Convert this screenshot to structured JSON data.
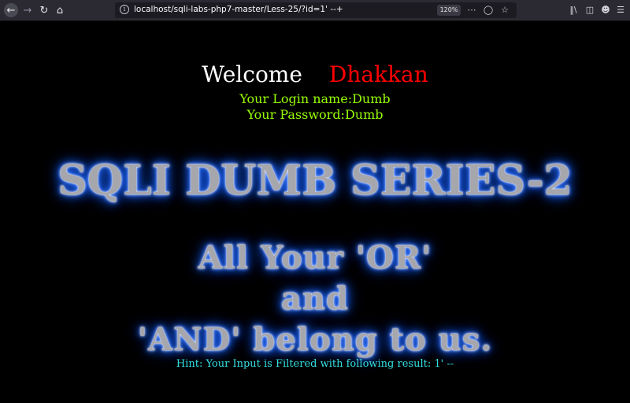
{
  "browser": {
    "url": "localhost/sqli-labs-php7-master/Less-25/?id=1' --+",
    "zoom": "120%"
  },
  "page": {
    "welcome": "Welcome",
    "username": "Dhakkan",
    "login_name": "Your Login name:Dumb",
    "password": "Your Password:Dumb",
    "title": "SQLI DUMB SERIES-2",
    "slogan_lines": [
      "All Your 'OR'",
      "and",
      "'AND' belong to us."
    ],
    "hint": "Hint: Your Input is Filtered with following result: 1' --"
  },
  "colors": {
    "background": "#000000",
    "welcome": "#ffffff",
    "username": "#ff0000",
    "credentials": "#99ff00",
    "hint": "#33e0e0",
    "glow": "#1f63ff"
  }
}
